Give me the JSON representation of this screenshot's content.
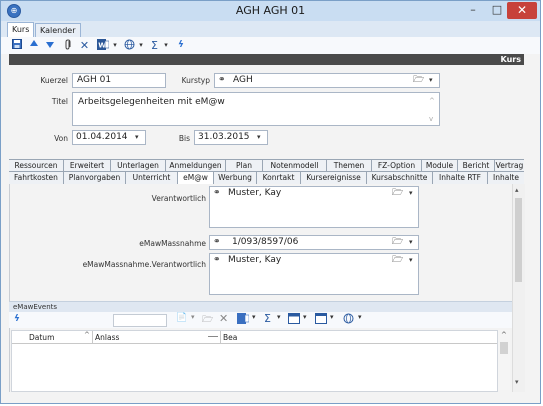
{
  "window": {
    "title": "AGH AGH 01",
    "minimize": "–",
    "maximize": "□",
    "close": "✕",
    "app_icon": "⊕"
  },
  "top_tabs": [
    "Kurs",
    "Kalender"
  ],
  "toolbar_icons": [
    "save-icon",
    "arrow-up-icon",
    "arrow-down-icon",
    "attach-icon",
    "delete-icon",
    "word-icon",
    "dropdown-icon",
    "globe-icon",
    "dropdown-icon",
    "sum-icon",
    "dropdown-icon",
    "link-icon"
  ],
  "band": {
    "title": "Kurs"
  },
  "form": {
    "kuerzel_label": "Kuerzel",
    "kuerzel_value": "AGH 01",
    "kurstyp_label": "Kurstyp",
    "kurstyp_value": "AGH",
    "titel_label": "Titel",
    "titel_value": "Arbeitsgelegenheiten mit eM@w",
    "von_label": "Von",
    "von_value": "01.04.2014",
    "bis_label": "Bis",
    "bis_value": "31.03.2015"
  },
  "tabs_row1": [
    "Ressourcen",
    "Erweitert",
    "Unterlagen",
    "Anmeldungen",
    "Plan",
    "Notenmodell",
    "Themen",
    "FZ-Option",
    "Module",
    "Bericht",
    "Vertrag"
  ],
  "tabs_row2": [
    "Fahrtkosten",
    "Planvorgaben",
    "Unterricht",
    "eM@w",
    "Werbung",
    "Konrtakt",
    "Kursereignisse",
    "Kursabschnitte",
    "Inhalte RTF",
    "Inhalte"
  ],
  "emaw": {
    "verantwortlich_label": "Verantwortlich",
    "verantwortlich_value": "Muster, Kay",
    "massnahme_label": "eMawMassnahme",
    "massnahme_value": "1/093/8597/06",
    "massnahme_verantwortlich_label": "eMawMassnahme.Verantwortlich",
    "massnahme_verantwortlich_value": "Muster, Kay"
  },
  "events": {
    "section_label": "eMawEvents",
    "columns": [
      "Datum",
      "Anlass",
      "Bea"
    ]
  }
}
